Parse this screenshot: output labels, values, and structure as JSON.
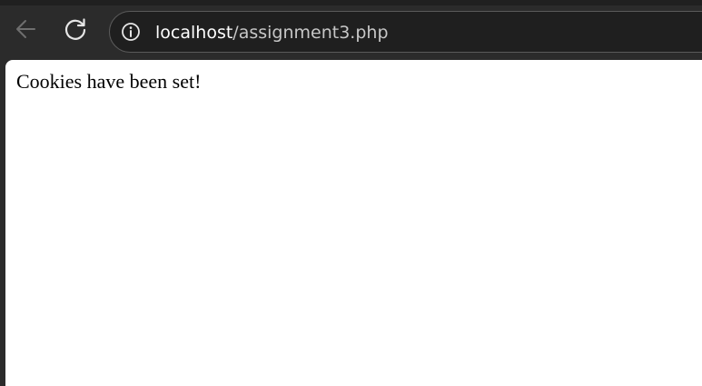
{
  "browser": {
    "icons": {
      "back": "arrow-left-icon",
      "reload": "reload-icon",
      "site_info": "info-circle-icon"
    },
    "address_bar": {
      "host": "localhost",
      "path": "/assignment3.php"
    }
  },
  "page": {
    "message": "Cookies have been set!"
  },
  "colors": {
    "chrome_background": "#2b2b2b",
    "omnibox_background": "#1f1f1f",
    "omnibox_border": "#5a5a5a",
    "url_host": "#ffffff",
    "url_path": "#c7c7c7",
    "page_background": "#ffffff",
    "page_text": "#000000"
  }
}
